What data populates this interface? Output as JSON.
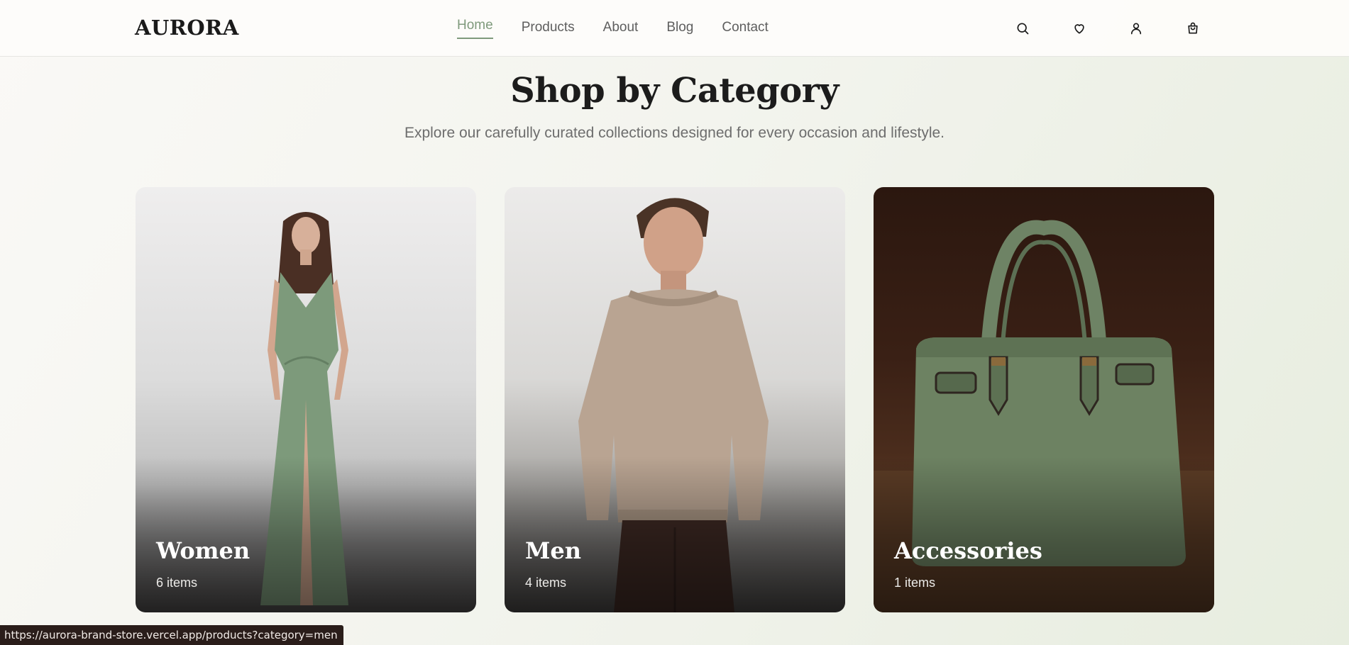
{
  "header": {
    "logo": "AURORA",
    "nav": [
      {
        "label": "Home",
        "active": true
      },
      {
        "label": "Products",
        "active": false
      },
      {
        "label": "About",
        "active": false
      },
      {
        "label": "Blog",
        "active": false
      },
      {
        "label": "Contact",
        "active": false
      }
    ],
    "icons": [
      "search-icon",
      "heart-icon",
      "user-icon",
      "cart-icon"
    ]
  },
  "section": {
    "title": "Shop by Category",
    "subtitle": "Explore our carefully curated collections designed for every occasion and lifestyle."
  },
  "categories": [
    {
      "name": "Women",
      "count": "6 items"
    },
    {
      "name": "Men",
      "count": "4 items"
    },
    {
      "name": "Accessories",
      "count": "1 items"
    }
  ],
  "status_bar": {
    "url": "https://aurora-brand-store.vercel.app/products?category=men"
  },
  "colors": {
    "accent": "#7f9a7c",
    "text": "#1a1a1a",
    "muted": "#6d6d6d"
  }
}
